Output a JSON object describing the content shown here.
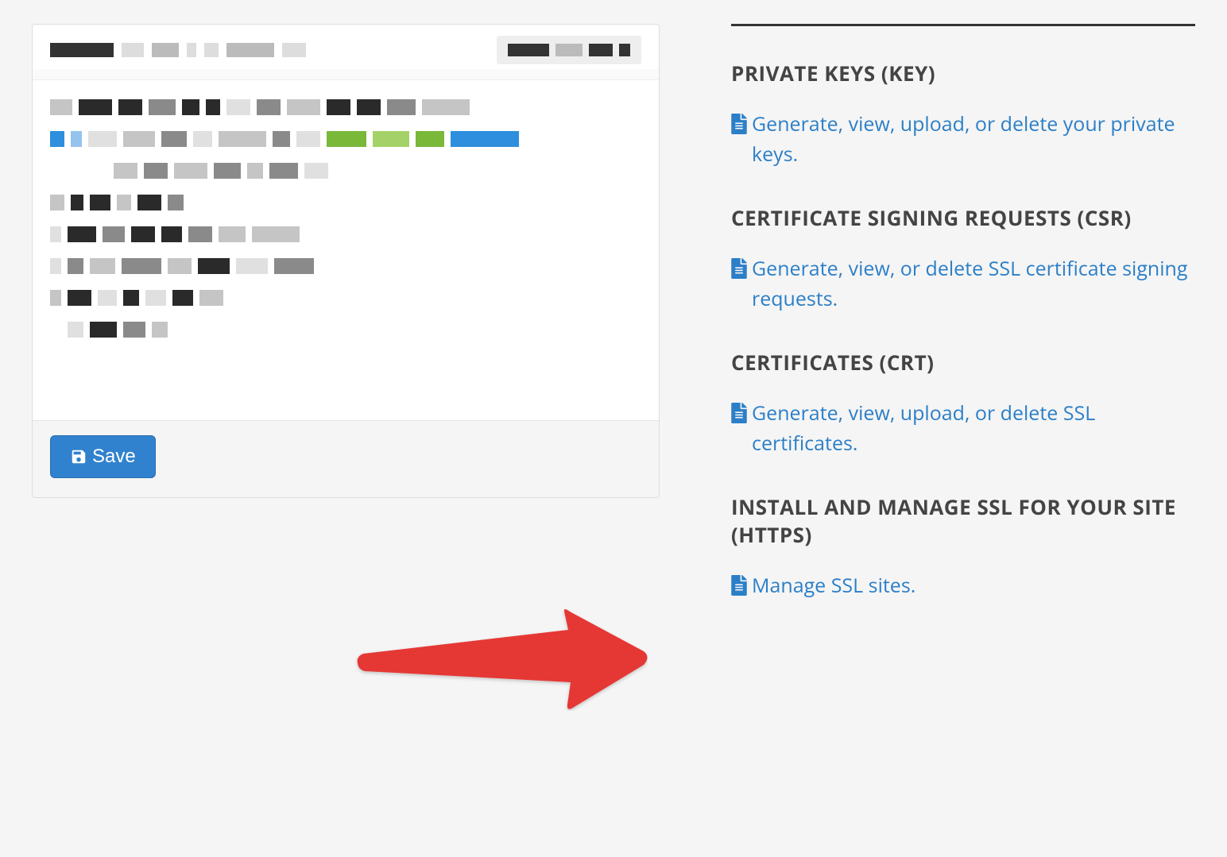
{
  "main": {
    "save_label": "Save"
  },
  "sidebar": {
    "sections": [
      {
        "heading": "PRIVATE KEYS (KEY)",
        "link_text": "Generate, view, upload, or delete your private keys."
      },
      {
        "heading": "CERTIFICATE SIGNING REQUESTS (CSR)",
        "link_text": "Generate, view, or delete SSL certificate signing requests."
      },
      {
        "heading": "CERTIFICATES (CRT)",
        "link_text": "Generate, view, upload, or delete SSL certificates."
      },
      {
        "heading": "INSTALL AND MANAGE SSL FOR YOUR SITE (HTTPS)",
        "link_text": "Manage SSL sites."
      }
    ]
  },
  "annotation": {
    "arrow_color": "#e53935"
  }
}
